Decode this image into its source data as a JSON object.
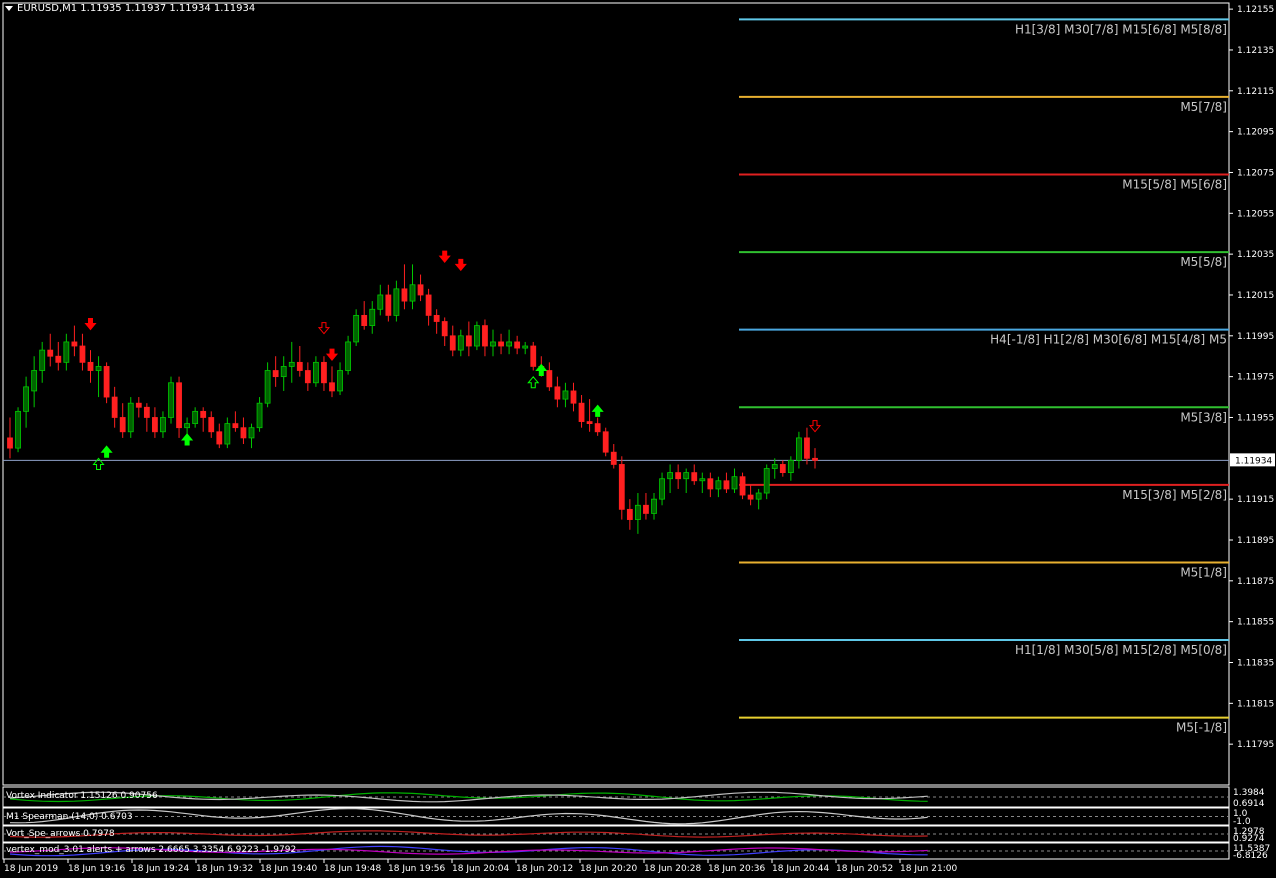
{
  "header": {
    "title": "EURUSD,M1  1.11935 1.11937 1.11934 1.11934"
  },
  "colors": {
    "bull": "#00c800",
    "bear": "#ff2020",
    "bull_body": "#006400",
    "grid": "#ffffff",
    "current_line": "#8ea0c8",
    "up_arrow": "#00ff00",
    "down_arrow": "#ff0000"
  },
  "chart_data": {
    "type": "candlestick",
    "symbol": "EURUSD",
    "timeframe": "M1",
    "ylim": [
      1.11775,
      1.12158
    ],
    "y_ticks": [
      "1.12155",
      "1.12135",
      "1.12115",
      "1.12095",
      "1.12075",
      "1.12055",
      "1.12035",
      "1.12015",
      "1.11995",
      "1.11975",
      "1.11955",
      "1.11915",
      "1.11895",
      "1.11875",
      "1.11855",
      "1.11835",
      "1.11815",
      "1.11795"
    ],
    "current_price": "1.11934",
    "x_ticks": [
      "18 Jun 2019",
      "18 Jun 19:16",
      "18 Jun 19:24",
      "18 Jun 19:32",
      "18 Jun 19:40",
      "18 Jun 19:48",
      "18 Jun 19:56",
      "18 Jun 20:04",
      "18 Jun 20:12",
      "18 Jun 20:20",
      "18 Jun 20:28",
      "18 Jun 20:36",
      "18 Jun 20:44",
      "18 Jun 20:52",
      "18 Jun 21:00"
    ],
    "candles": [
      [
        1.11945,
        1.11955,
        1.11935,
        1.1194
      ],
      [
        1.1194,
        1.1196,
        1.11938,
        1.11958
      ],
      [
        1.11958,
        1.11975,
        1.1195,
        1.1197
      ],
      [
        1.11968,
        1.11985,
        1.1196,
        1.11978
      ],
      [
        1.11978,
        1.11992,
        1.11972,
        1.11988
      ],
      [
        1.11988,
        1.11996,
        1.1198,
        1.11985
      ],
      [
        1.11985,
        1.11992,
        1.11978,
        1.11982
      ],
      [
        1.11982,
        1.11996,
        1.11978,
        1.11992
      ],
      [
        1.11992,
        1.12,
        1.11985,
        1.1199
      ],
      [
        1.1199,
        1.11996,
        1.11978,
        1.11982
      ],
      [
        1.11982,
        1.11988,
        1.11972,
        1.11978
      ],
      [
        1.11978,
        1.11985,
        1.11965,
        1.1198
      ],
      [
        1.1198,
        1.11982,
        1.11962,
        1.11965
      ],
      [
        1.11965,
        1.1197,
        1.1195,
        1.11955
      ],
      [
        1.11955,
        1.11962,
        1.11945,
        1.11948
      ],
      [
        1.11948,
        1.11965,
        1.11945,
        1.11962
      ],
      [
        1.11962,
        1.11965,
        1.11955,
        1.1196
      ],
      [
        1.1196,
        1.11962,
        1.11948,
        1.11955
      ],
      [
        1.11955,
        1.1196,
        1.11945,
        1.11948
      ],
      [
        1.11948,
        1.11958,
        1.11945,
        1.11955
      ],
      [
        1.11955,
        1.11975,
        1.11952,
        1.11972
      ],
      [
        1.11972,
        1.11975,
        1.11945,
        1.1195
      ],
      [
        1.1195,
        1.11955,
        1.11945,
        1.11952
      ],
      [
        1.11952,
        1.1196,
        1.1195,
        1.11958
      ],
      [
        1.11958,
        1.1196,
        1.11948,
        1.11955
      ],
      [
        1.11955,
        1.11958,
        1.11945,
        1.11948
      ],
      [
        1.11948,
        1.11952,
        1.1194,
        1.11942
      ],
      [
        1.11942,
        1.11955,
        1.1194,
        1.11952
      ],
      [
        1.11952,
        1.11958,
        1.11948,
        1.1195
      ],
      [
        1.1195,
        1.11955,
        1.11942,
        1.11945
      ],
      [
        1.11945,
        1.11952,
        1.1194,
        1.1195
      ],
      [
        1.1195,
        1.11965,
        1.11948,
        1.11962
      ],
      [
        1.11962,
        1.11982,
        1.1196,
        1.11978
      ],
      [
        1.11978,
        1.11985,
        1.1197,
        1.11975
      ],
      [
        1.11975,
        1.11985,
        1.11968,
        1.1198
      ],
      [
        1.1198,
        1.11992,
        1.11972,
        1.11982
      ],
      [
        1.11982,
        1.1199,
        1.11975,
        1.11978
      ],
      [
        1.11978,
        1.11982,
        1.11968,
        1.11972
      ],
      [
        1.11972,
        1.11985,
        1.1197,
        1.11982
      ],
      [
        1.11982,
        1.11985,
        1.11968,
        1.11972
      ],
      [
        1.11972,
        1.1198,
        1.11965,
        1.11968
      ],
      [
        1.11968,
        1.11982,
        1.11966,
        1.11978
      ],
      [
        1.11978,
        1.11995,
        1.11976,
        1.11992
      ],
      [
        1.11992,
        1.12008,
        1.1199,
        1.12005
      ],
      [
        1.12005,
        1.12012,
        1.11998,
        1.12
      ],
      [
        1.12,
        1.12012,
        1.11996,
        1.12008
      ],
      [
        1.12008,
        1.1202,
        1.12005,
        1.12015
      ],
      [
        1.12015,
        1.1202,
        1.12002,
        1.12005
      ],
      [
        1.12005,
        1.12022,
        1.12002,
        1.12018
      ],
      [
        1.12018,
        1.1203,
        1.12008,
        1.12012
      ],
      [
        1.12012,
        1.1203,
        1.12008,
        1.1202
      ],
      [
        1.1202,
        1.12025,
        1.12012,
        1.12015
      ],
      [
        1.12015,
        1.12018,
        1.12,
        1.12005
      ],
      [
        1.12005,
        1.12008,
        1.11996,
        1.12002
      ],
      [
        1.12002,
        1.12004,
        1.1199,
        1.11995
      ],
      [
        1.11995,
        1.12,
        1.11985,
        1.11988
      ],
      [
        1.11988,
        1.11998,
        1.11985,
        1.11995
      ],
      [
        1.11995,
        1.12002,
        1.11985,
        1.1199
      ],
      [
        1.1199,
        1.12002,
        1.11988,
        1.12
      ],
      [
        1.12,
        1.12003,
        1.11985,
        1.1199
      ],
      [
        1.1199,
        1.11998,
        1.11985,
        1.11992
      ],
      [
        1.11992,
        1.11996,
        1.11986,
        1.1199
      ],
      [
        1.1199,
        1.11998,
        1.11986,
        1.11992
      ],
      [
        1.11992,
        1.11995,
        1.11986,
        1.11989
      ],
      [
        1.11989,
        1.11992,
        1.11986,
        1.1199
      ],
      [
        1.1199,
        1.11992,
        1.11978,
        1.1198
      ],
      [
        1.1198,
        1.11985,
        1.11975,
        1.11978
      ],
      [
        1.11978,
        1.11982,
        1.11968,
        1.1197
      ],
      [
        1.1197,
        1.11975,
        1.1196,
        1.11964
      ],
      [
        1.11964,
        1.11972,
        1.1196,
        1.11968
      ],
      [
        1.11968,
        1.11972,
        1.11958,
        1.11962
      ],
      [
        1.11962,
        1.11966,
        1.1195,
        1.11953
      ],
      [
        1.11953,
        1.11964,
        1.11948,
        1.11952
      ],
      [
        1.11952,
        1.11955,
        1.11946,
        1.11948
      ],
      [
        1.11948,
        1.1195,
        1.11936,
        1.11938
      ],
      [
        1.11938,
        1.11942,
        1.1193,
        1.11932
      ],
      [
        1.11932,
        1.11936,
        1.11905,
        1.1191
      ],
      [
        1.1191,
        1.11915,
        1.119,
        1.11905
      ],
      [
        1.11905,
        1.11918,
        1.11898,
        1.11912
      ],
      [
        1.11912,
        1.11918,
        1.11905,
        1.11908
      ],
      [
        1.11908,
        1.11918,
        1.11905,
        1.11915
      ],
      [
        1.11915,
        1.11928,
        1.11912,
        1.11925
      ],
      [
        1.11925,
        1.11932,
        1.11918,
        1.11928
      ],
      [
        1.11928,
        1.11932,
        1.1192,
        1.11925
      ],
      [
        1.11925,
        1.1193,
        1.11918,
        1.11928
      ],
      [
        1.11928,
        1.11932,
        1.11922,
        1.11924
      ],
      [
        1.11924,
        1.11928,
        1.11918,
        1.11925
      ],
      [
        1.11925,
        1.11928,
        1.11916,
        1.1192
      ],
      [
        1.1192,
        1.11926,
        1.11916,
        1.11924
      ],
      [
        1.11924,
        1.11928,
        1.11918,
        1.1192
      ],
      [
        1.1192,
        1.1193,
        1.11918,
        1.11926
      ],
      [
        1.11926,
        1.11928,
        1.11915,
        1.11917
      ],
      [
        1.11917,
        1.11922,
        1.11912,
        1.11915
      ],
      [
        1.11915,
        1.1192,
        1.1191,
        1.11918
      ],
      [
        1.11918,
        1.11932,
        1.11915,
        1.1193
      ],
      [
        1.1193,
        1.11935,
        1.11925,
        1.11932
      ],
      [
        1.11932,
        1.11934,
        1.11926,
        1.11928
      ],
      [
        1.11928,
        1.11936,
        1.11924,
        1.11934
      ],
      [
        1.11934,
        1.11948,
        1.1193,
        1.11945
      ],
      [
        1.11945,
        1.1195,
        1.11932,
        1.11935
      ],
      [
        1.11935,
        1.1194,
        1.1193,
        1.11934
      ]
    ],
    "levels": [
      {
        "label": "H1[3/8] M30[7/8] M15[6/8] M5[8/8]",
        "price": 1.1215,
        "color": "#5fc8e8"
      },
      {
        "label": "M5[7/8]",
        "price": 1.12112,
        "color": "#e8b030"
      },
      {
        "label": "M15[5/8] M5[6/8]",
        "price": 1.12074,
        "color": "#e02020"
      },
      {
        "label": "M5[5/8]",
        "price": 1.12036,
        "color": "#30c030"
      },
      {
        "label": "H4[-1/8] H1[2/8] M30[6/8] M15[4/8] M5",
        "price": 1.11998,
        "color": "#4aa8e0"
      },
      {
        "label": "M5[3/8]",
        "price": 1.1196,
        "color": "#30c030"
      },
      {
        "label": "M15[3/8] M5[2/8]",
        "price": 1.11922,
        "color": "#e02020"
      },
      {
        "label": "M5[1/8]",
        "price": 1.11884,
        "color": "#e8b030"
      },
      {
        "label": "H1[1/8] M30[5/8] M15[2/8] M5[0/8]",
        "price": 1.11846,
        "color": "#5fc8e8"
      },
      {
        "label": "M5[-1/8]",
        "price": 1.11808,
        "color": "#e8d030"
      }
    ],
    "arrows": [
      {
        "i": 12,
        "dir": "up",
        "price": 1.11938,
        "style": "solid"
      },
      {
        "i": 11,
        "dir": "up",
        "price": 1.11932,
        "style": "outline"
      },
      {
        "i": 22,
        "dir": "up",
        "price": 1.11944,
        "style": "solid"
      },
      {
        "i": 10,
        "dir": "down",
        "price": 1.12001,
        "style": "solid"
      },
      {
        "i": 39,
        "dir": "down",
        "price": 1.11999,
        "style": "outline"
      },
      {
        "i": 40,
        "dir": "down",
        "price": 1.11986,
        "style": "solid"
      },
      {
        "i": 54,
        "dir": "down",
        "price": 1.12034,
        "style": "solid"
      },
      {
        "i": 56,
        "dir": "down",
        "price": 1.1203,
        "style": "solid"
      },
      {
        "i": 66,
        "dir": "up",
        "price": 1.11978,
        "style": "solid"
      },
      {
        "i": 65,
        "dir": "up",
        "price": 1.11972,
        "style": "outline"
      },
      {
        "i": 73,
        "dir": "up",
        "price": 1.11958,
        "style": "solid"
      },
      {
        "i": 100,
        "dir": "down",
        "price": 1.11951,
        "style": "outline"
      }
    ]
  },
  "indicators": [
    {
      "label": "Vortex Indicator 1.15126 0.90756",
      "values": [
        "1.3984",
        "0.6914"
      ]
    },
    {
      "label": "M1 Spearman (14,0) 0.6703",
      "values": [
        "1.0",
        "-1.0"
      ]
    },
    {
      "label": "Vort_Spe_arrows 0.7978",
      "values": [
        "1.2978",
        "0.9274"
      ]
    },
    {
      "label": "vertex_mod_3.01 alerts + arrows 2.6665 3.3354 6.9223 -1.9792",
      "values": [
        "11.5387",
        "-6.8126"
      ]
    }
  ]
}
